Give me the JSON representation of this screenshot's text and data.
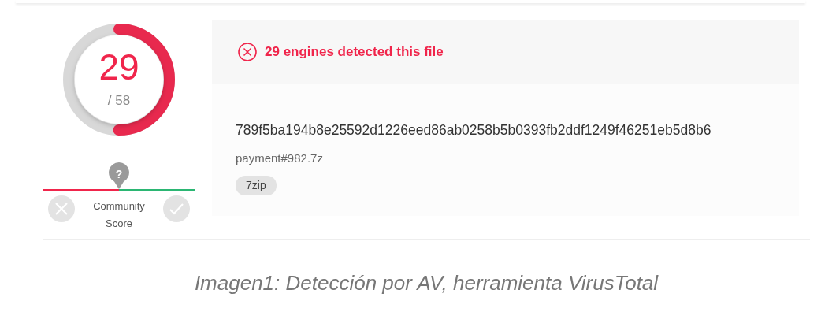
{
  "detection": {
    "positives": "29",
    "total": "/ 58"
  },
  "community_score": {
    "label": "Community Score",
    "help": "?"
  },
  "alert": {
    "message": "29 engines detected this file"
  },
  "file": {
    "hash": "789f5ba194b8e25592d1226eed86ab0258b5b0393fb2ddf1249f46251eb5d8b6",
    "name": "payment#982.7z",
    "tags": [
      "7zip"
    ]
  },
  "caption": "Imagen1: Detección por AV, herramienta VirusTotal"
}
